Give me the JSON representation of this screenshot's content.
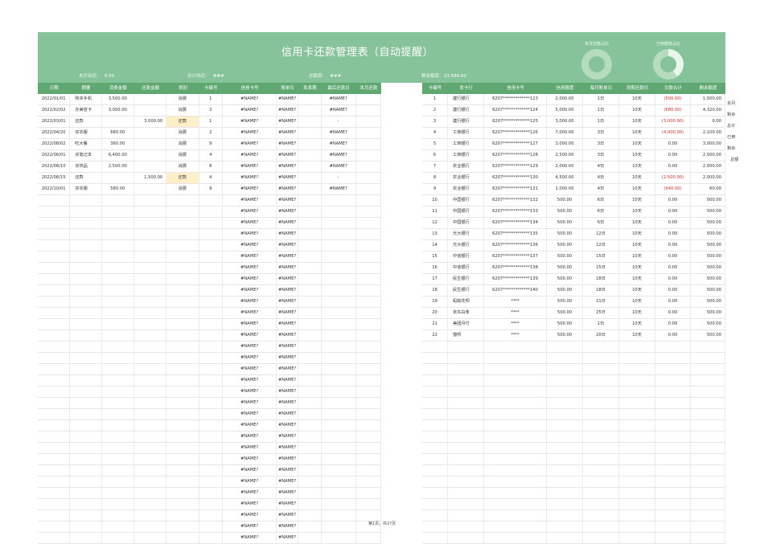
{
  "title": "信用卡还款管理表（自动提醒）",
  "summary": {
    "month_due_label": "本月待还:",
    "month_due_value": "0.00",
    "total_due_label": "总计待还:",
    "total_due_value": "###",
    "total_limit_label": "总额度:",
    "total_limit_value": "###",
    "remaining_label": "剩余额度:",
    "remaining_value": "23,980.00"
  },
  "donuts": {
    "month_ratio_label": "本月还款占比",
    "used_ratio_label": "已用额度占比",
    "used_ratio_fraction": 0.4
  },
  "left_headers": [
    "日期",
    "摘要",
    "消费金额",
    "还款金额",
    "类别",
    "卡编号",
    "信用卡号",
    "账单日",
    "免息期",
    "最后还款日",
    "本月还款"
  ],
  "left_rows": [
    [
      "2022/01/01",
      "购买手机",
      "3,500.00",
      "",
      "消费",
      "1",
      "#NAME?",
      "#NAME?",
      "",
      "#NAME?",
      ""
    ],
    [
      "2022/02/02",
      "办美容卡",
      "3,000.00",
      "",
      "消费",
      "3",
      "#NAME?",
      "#NAME?",
      "",
      "#NAME?",
      ""
    ],
    [
      "2022/03/01",
      "还款",
      "",
      "3,000.00",
      "还款",
      "1",
      "#NAME?",
      "#NAME?",
      "",
      "-",
      ""
    ],
    [
      "2022/04/20",
      "买衣服",
      "680.00",
      "",
      "消费",
      "2",
      "#NAME?",
      "#NAME?",
      "",
      "#NAME?",
      ""
    ],
    [
      "2022/08/02",
      "吃大餐",
      "360.00",
      "",
      "消费",
      "9",
      "#NAME?",
      "#NAME?",
      "",
      "#NAME?",
      ""
    ],
    [
      "2022/06/01",
      "买笔记本",
      "6,400.00",
      "",
      "消费",
      "4",
      "#NAME?",
      "#NAME?",
      "",
      "#NAME?",
      ""
    ],
    [
      "2022/08/10",
      "买饰品",
      "2,500.00",
      "",
      "消费",
      "8",
      "#NAME?",
      "#NAME?",
      "",
      "#NAME?",
      ""
    ],
    [
      "2022/08/15",
      "还款",
      "",
      "1,500.00",
      "还款",
      "4",
      "#NAME?",
      "#NAME?",
      "",
      "-",
      ""
    ],
    [
      "2022/10/01",
      "买衣服",
      "580.00",
      "",
      "消费",
      "9",
      "#NAME?",
      "#NAME?",
      "",
      "#NAME?",
      ""
    ]
  ],
  "left_error_text": "#NAME?",
  "right_headers": [
    "卡编号",
    "发卡行",
    "信用卡号",
    "信用额度",
    "每月账单日",
    "到期还款日",
    "欠款合计",
    "剩余额度"
  ],
  "right_rows": [
    [
      "1",
      "建行银行",
      "6207*************123",
      "2,000.00",
      "1日",
      "10天",
      "(500.00)",
      "1,500.00"
    ],
    [
      "2",
      "建行银行",
      "6207*************124",
      "5,000.00",
      "1日",
      "10天",
      "(680.00)",
      "4,320.00"
    ],
    [
      "3",
      "建行银行",
      "6207*************125",
      "3,000.00",
      "1日",
      "10天",
      "(3,000.00)",
      "0.00"
    ],
    [
      "4",
      "工商银行",
      "6207*************126",
      "7,000.00",
      "3日",
      "10天",
      "(4,900.00)",
      "2,100.00"
    ],
    [
      "5",
      "工商银行",
      "6207*************127",
      "3,000.00",
      "3日",
      "10天",
      "0.00",
      "3,000.00"
    ],
    [
      "6",
      "工商银行",
      "6207*************128",
      "2,500.00",
      "3日",
      "10天",
      "0.00",
      "2,500.00"
    ],
    [
      "7",
      "农业银行",
      "6207*************129",
      "2,000.00",
      "4日",
      "10天",
      "0.00",
      "2,000.00"
    ],
    [
      "8",
      "农业银行",
      "6207*************130",
      "4,500.00",
      "4日",
      "10天",
      "(2,500.00)",
      "2,000.00"
    ],
    [
      "9",
      "农业银行",
      "6207*************131",
      "1,000.00",
      "4日",
      "10天",
      "(940.00)",
      "60.00"
    ],
    [
      "10",
      "中国银行",
      "6207*************132",
      "500.00",
      "6日",
      "10天",
      "0.00",
      "500.00"
    ],
    [
      "11",
      "中国银行",
      "6207*************133",
      "500.00",
      "6日",
      "10天",
      "0.00",
      "500.00"
    ],
    [
      "12",
      "中国银行",
      "6207*************134",
      "500.00",
      "6日",
      "10天",
      "0.00",
      "500.00"
    ],
    [
      "13",
      "光大银行",
      "6207*************135",
      "500.00",
      "12日",
      "10天",
      "0.00",
      "500.00"
    ],
    [
      "14",
      "光大银行",
      "6207*************136",
      "500.00",
      "12日",
      "10天",
      "0.00",
      "500.00"
    ],
    [
      "15",
      "中信银行",
      "6207*************137",
      "500.00",
      "15日",
      "10天",
      "0.00",
      "500.00"
    ],
    [
      "16",
      "中信银行",
      "6207*************138",
      "500.00",
      "15日",
      "10天",
      "0.00",
      "500.00"
    ],
    [
      "17",
      "民生银行",
      "6207*************139",
      "500.00",
      "18日",
      "10天",
      "0.00",
      "500.00"
    ],
    [
      "18",
      "民生银行",
      "6207*************140",
      "500.00",
      "18日",
      "10天",
      "0.00",
      "500.00"
    ],
    [
      "19",
      "蚂蚁花呗",
      "****",
      "500.00",
      "21日",
      "10天",
      "0.00",
      "500.00"
    ],
    [
      "20",
      "京东白条",
      "****",
      "500.00",
      "25日",
      "10天",
      "0.00",
      "500.00"
    ],
    [
      "21",
      "美团月付",
      "****",
      "500.00",
      "1日",
      "10天",
      "0.00",
      "500.00"
    ],
    [
      "22",
      "借呗",
      "****",
      "500.00",
      "20日",
      "10天",
      "0.00",
      "500.00"
    ]
  ],
  "side_labels": [
    "本月",
    "剩余",
    "总计",
    "已用",
    "剩余",
    "总额"
  ],
  "footer": "第1页，共2?页",
  "colors": {
    "banner": "#86c39a",
    "header": "#5fa872",
    "highlight": "#fdf0c8",
    "negative": "#d6302a"
  }
}
